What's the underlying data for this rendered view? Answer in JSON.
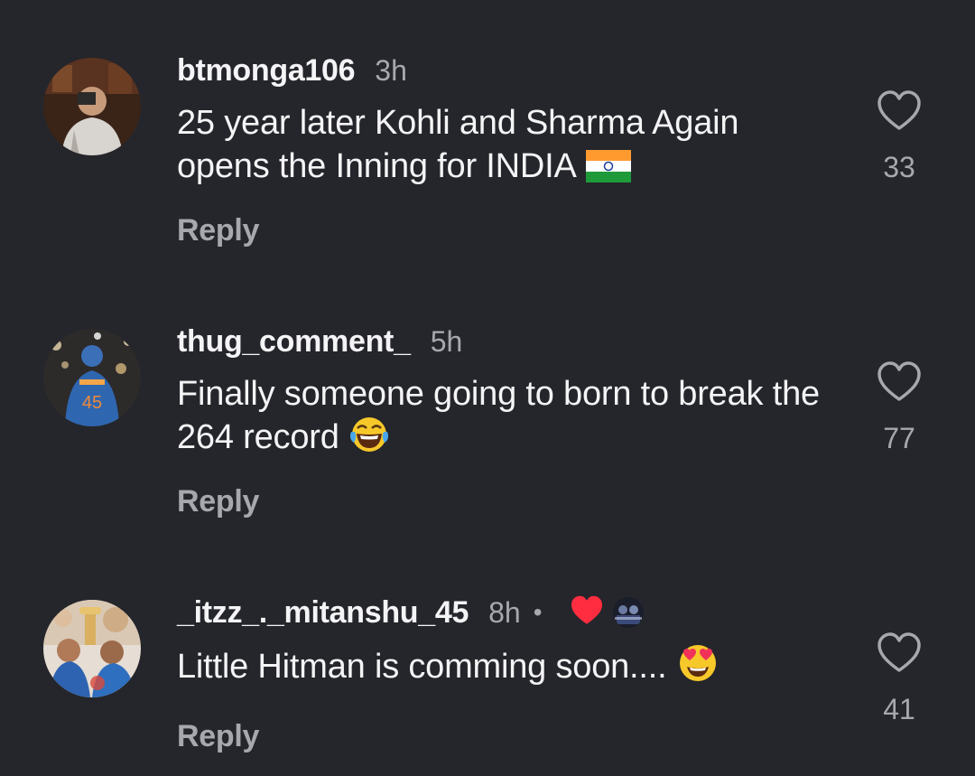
{
  "comments": [
    {
      "username": "btmonga106",
      "time": "3h",
      "text": "25 year later Kohli and Sharma Again opens the Inning for INDIA",
      "emoji": "india-flag",
      "reply_label": "Reply",
      "like_count": "33"
    },
    {
      "username": "thug_comment_",
      "time": "5h",
      "text": "Finally someone going to born to break the 264 record",
      "emoji": "laughing-tears",
      "reply_label": "Reply",
      "like_count": "77"
    },
    {
      "username": "_itzz_._mitanshu_45",
      "time": "8h",
      "separator": "•",
      "liked_by_author": true,
      "text": "Little Hitman is comming soon....",
      "emoji": "heart-eyes",
      "reply_label": "Reply",
      "like_count": "41"
    }
  ],
  "colors": {
    "background": "#25262b",
    "primary_text": "#f4f4f6",
    "secondary_text": "#a7a8ae",
    "heart_red": "#ff2d3f"
  }
}
